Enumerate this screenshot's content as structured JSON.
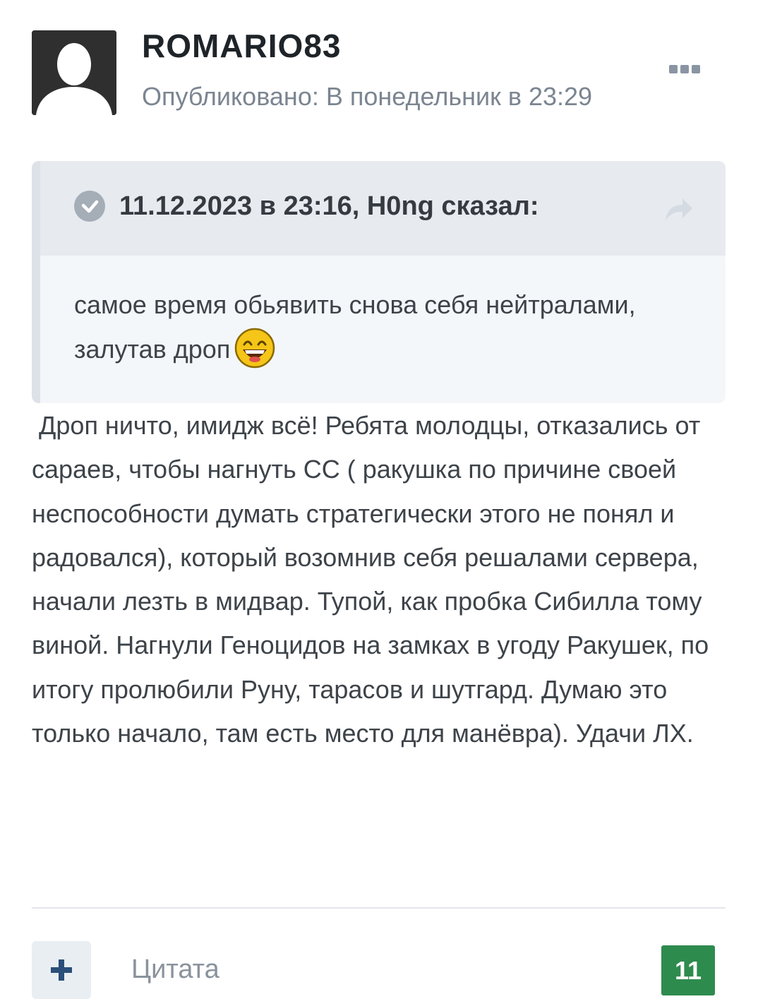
{
  "post": {
    "author": "ROMARIO83",
    "meta": "Опубликовано: В понедельник в 23:29",
    "avatar_icon": "user-silhouette-icon",
    "more_icon": "more-dots-icon"
  },
  "quote": {
    "citation": "11.12.2023 в 23:16, H0ng сказал:",
    "text": "самое время обьявить снова себя нейтралами, залутав дроп",
    "emoji_icon": "laughing-smiley-icon",
    "check_icon": "check-circle-icon",
    "share_icon": "share-arrow-icon"
  },
  "body": {
    "text": " Дроп ничто, имидж всё! Ребята молодцы, отказались от сараев, чтобы нагнуть СС ( ракушка по причине своей неспособности думать стратегически этого не понял и радовался), который возомнив себя решалами сервера, начали лезть в мидвар. Тупой, как пробка Сибилла тому виной. Нагнули Геноцидов на замках в угоду Ракушек, по итогу пролюбили Руну, тарасов и шутгард. Думаю это только начало, там есть место для манёвра). Удачи ЛХ."
  },
  "footer": {
    "plus_icon": "plus-icon",
    "quote_label": "Цитата",
    "reputation": "11"
  },
  "colors": {
    "reputation_badge": "#2e8b4e",
    "meta_text": "#7b8591",
    "quote_background": "#f4f7fa"
  }
}
